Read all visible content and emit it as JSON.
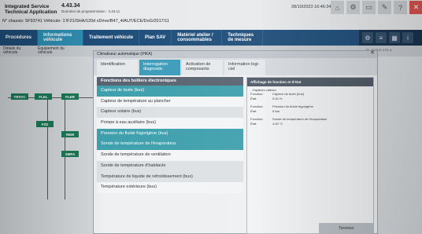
{
  "header": {
    "app_title": "Integrated Service Technical Application",
    "version": "4.43.34",
    "sub": "Données de programmation : 4.43.11",
    "chassis": "N° chassis: 5F93741   Véhicule: 1'/F21/SHA/120d xDrive/B47_4/AUT/ECE/DoG/2017/11",
    "datetime": "28/10/2023 16:46:34"
  },
  "nav": [
    "Procédures",
    "Informations véhicule",
    "Traitement véhicule",
    "Plan SAV",
    "Matériel atelier / consommables",
    "Techniques de mesure"
  ],
  "subnav": {
    "left": "Détails du véhicule",
    "mid": "Équipement du véhicule",
    "right_info": "RL 10  FUS 4  RL 6"
  },
  "dialog": {
    "title": "Climatiseur automatique (IHKA)",
    "tabs": [
      "Identification",
      "Interrogation diagnostic",
      "Activation de composants",
      "Information logi-ciel"
    ],
    "list_header": "Fonctions des boîtiers électroniques",
    "items": [
      "Capteur de buée (bus)",
      "Capteur de température au plancher",
      "Capteur solaire (bus)",
      "Pompe à eau auxiliaire (bus)",
      "Pression du fluide frigorigène (bus)",
      "Sonde de température de l'évaporateur",
      "Sonde de température de ventilation",
      "Sonde de température d'habitacle",
      "Température de liquide de refroidissement (bus)",
      "Température extérieure (bus)"
    ],
    "detail_header": "Affichage de fonction et d'état",
    "detail_section": "- Capteurs valeurs",
    "detail_rows": [
      [
        "Fonction:",
        "Capteur de buée (bus)"
      ],
      [
        "État:",
        "0.00 %"
      ],
      [
        "Fonction:",
        "Pression du fluide frigorigène"
      ],
      [
        "État:",
        "6 bar"
      ],
      [
        "Fonction:",
        "Sonde de température de l'évaporateur"
      ],
      [
        "État:",
        "4.00 °C"
      ]
    ],
    "bottom_button": "Terminer"
  },
  "diagram": [
    "TRSVC",
    "FLEL",
    "FLER",
    "FZD",
    "REM",
    "SMFA"
  ]
}
